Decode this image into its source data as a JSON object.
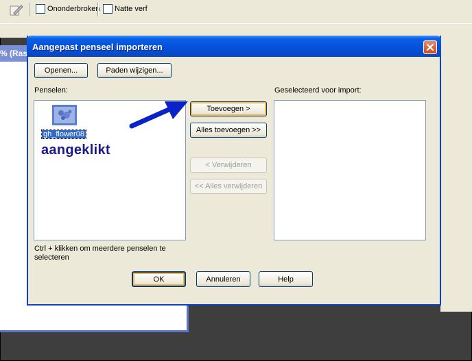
{
  "toolbar": {
    "checkbox_continuous": "Ononderbroken",
    "checkbox_wet_paint": "Natte verf"
  },
  "document": {
    "title_fragment": "% (Ras"
  },
  "dialog": {
    "title": "Aangepast penseel importeren",
    "open_button": "Openen...",
    "edit_paths_button": "Paden wijzigen...",
    "brushes_label": "Penselen:",
    "selected_label": "Geselecteerd voor import:",
    "brushes": [
      {
        "name": "gh_flower08",
        "selected": true
      }
    ],
    "annotation": "aangeklikt",
    "add_button": "Toevoegen >",
    "add_all_button": "Alles toevoegen >>",
    "remove_button": "< Verwijderen",
    "remove_all_button": "<< Alles verwijderen",
    "hint_text": "Ctrl + klikken om meerdere penselen te selecteren",
    "ok_button": "OK",
    "cancel_button": "Annuleren",
    "help_button": "Help"
  },
  "colors": {
    "titlebar": "#0550d8",
    "selection": "#316ac5",
    "annotation_arrow": "#0a22c8"
  }
}
